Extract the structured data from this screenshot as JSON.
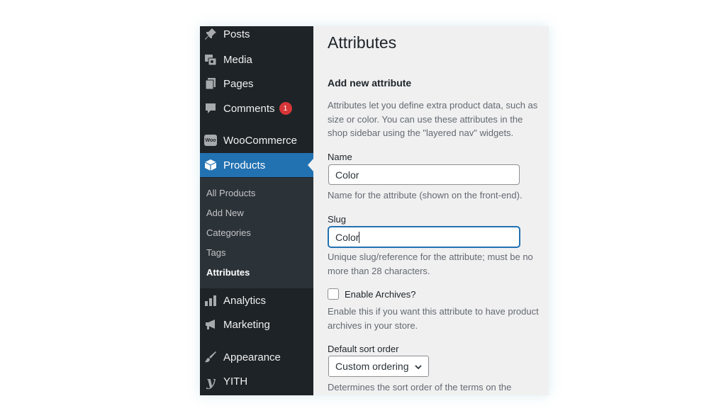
{
  "sidebar": {
    "items": [
      {
        "label": "Posts",
        "icon": "pin-icon"
      },
      {
        "label": "Media",
        "icon": "media-icon"
      },
      {
        "label": "Pages",
        "icon": "pages-icon"
      },
      {
        "label": "Comments",
        "icon": "comment-icon",
        "badge": "1"
      },
      {
        "label": "WooCommerce",
        "icon": "woo-icon",
        "icon_text": "Woo"
      },
      {
        "label": "Products",
        "icon": "box-icon",
        "active": true
      },
      {
        "label": "Analytics",
        "icon": "bar-chart-icon"
      },
      {
        "label": "Marketing",
        "icon": "megaphone-icon"
      },
      {
        "label": "Appearance",
        "icon": "brush-icon"
      },
      {
        "label": "YITH",
        "icon": "yith-icon",
        "icon_text": "y"
      }
    ],
    "submenu": [
      "All Products",
      "Add New",
      "Categories",
      "Tags",
      "Attributes"
    ],
    "current_submenu": "Attributes"
  },
  "main": {
    "title": "Attributes",
    "section_title": "Add new attribute",
    "intro": "Attributes let you define extra product data, such as size or color. You can use these attributes in the shop sidebar using the \"layered nav\" widgets.",
    "name": {
      "label": "Name",
      "value": "Color",
      "help": "Name for the attribute (shown on the front-end)."
    },
    "slug": {
      "label": "Slug",
      "value": "Color",
      "help": "Unique slug/reference for the attribute; must be no more than 28 characters."
    },
    "archives": {
      "label": "Enable Archives?",
      "help": "Enable this if you want this attribute to have product archives in your store.",
      "checked": false
    },
    "sort": {
      "label": "Default sort order",
      "value": "Custom ordering",
      "help": "Determines the sort order of the terms on the"
    }
  },
  "colors": {
    "sidebar_bg": "#1d2327",
    "submenu_bg": "#2c3338",
    "active": "#2271b1",
    "badge": "#d63638",
    "content_bg": "#f0f0f1"
  }
}
